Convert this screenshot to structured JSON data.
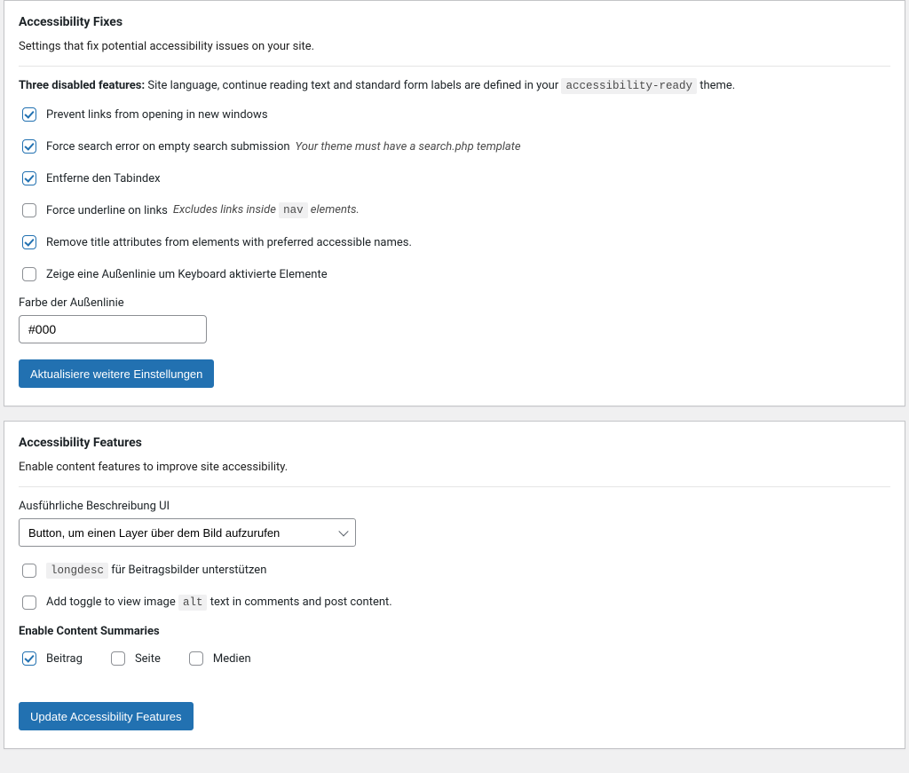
{
  "fixes": {
    "heading": "Accessibility Fixes",
    "desc": "Settings that fix potential accessibility issues on your site.",
    "disabled_lead": "Three disabled features: ",
    "disabled_text_before": "Site language, continue reading text and standard form labels are defined in your ",
    "disabled_code": "accessibility-ready",
    "disabled_text_after": " theme.",
    "options": {
      "prevent_new_windows": {
        "label": "Prevent links from opening in new windows",
        "checked": true
      },
      "force_search_error": {
        "label": "Force search error on empty search submission",
        "note": "Your theme must have a search.php template",
        "checked": true
      },
      "remove_tabindex": {
        "label": "Entferne den Tabindex",
        "checked": true
      },
      "force_underline": {
        "label": "Force underline on links",
        "note_before": "Excludes links inside ",
        "note_code": "nav",
        "note_after": " elements.",
        "checked": false
      },
      "remove_title_attrs": {
        "label": "Remove title attributes from elements with preferred accessible names.",
        "checked": true
      },
      "show_outline": {
        "label": "Zeige eine Außenlinie um Keyboard aktivierte Elemente",
        "checked": false
      }
    },
    "outline_color": {
      "label": "Farbe der Außenlinie",
      "value": "#000"
    },
    "submit": "Aktualisiere weitere Einstellungen"
  },
  "features": {
    "heading": "Accessibility Features",
    "desc": "Enable content features to improve site accessibility.",
    "longdesc_ui_label": "Ausführliche Beschreibung UI",
    "longdesc_ui_value": "Button, um einen Layer über dem Bild aufzurufen",
    "longdesc_support": {
      "code": "longdesc",
      "label_after": " für Beitragsbilder unterstützen",
      "checked": false
    },
    "alt_toggle": {
      "label_before": "Add toggle to view image ",
      "code": "alt",
      "label_after": " text in comments and post content.",
      "checked": false
    },
    "summaries_heading": "Enable Content Summaries",
    "summaries": {
      "post": {
        "label": "Beitrag",
        "checked": true
      },
      "page": {
        "label": "Seite",
        "checked": false
      },
      "media": {
        "label": "Medien",
        "checked": false
      }
    },
    "submit": "Update Accessibility Features"
  }
}
